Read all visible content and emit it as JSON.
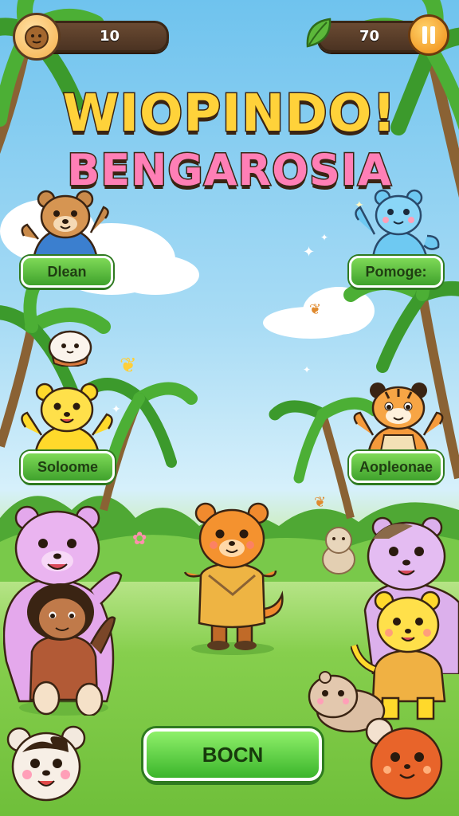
{
  "hud": {
    "left_counter": "10",
    "right_counter": "70",
    "left_icon": "coconut-coin-icon",
    "right_icon": "leaf-icon",
    "pause_icon": "pause-icon"
  },
  "title": {
    "line1": "WIOPINDO!",
    "line2": "BENGAROSIA"
  },
  "characters": [
    {
      "name_label": "Dlean",
      "icon": "bear-character"
    },
    {
      "name_label": "Pomoge:",
      "icon": "blue-bear-character"
    },
    {
      "name_label": "Soloome",
      "icon": "yellow-bear-character"
    },
    {
      "name_label": "Aoplеonae",
      "icon": "tiger-character"
    }
  ],
  "main_button": "BOCN",
  "colors": {
    "sky": "#6fc3ee",
    "grass": "#6fbf3a",
    "button_green": "#3fa22c",
    "hud_brown": "#4b3322",
    "title_yellow": "#ffd23a",
    "title_pink": "#ff7fb6"
  }
}
